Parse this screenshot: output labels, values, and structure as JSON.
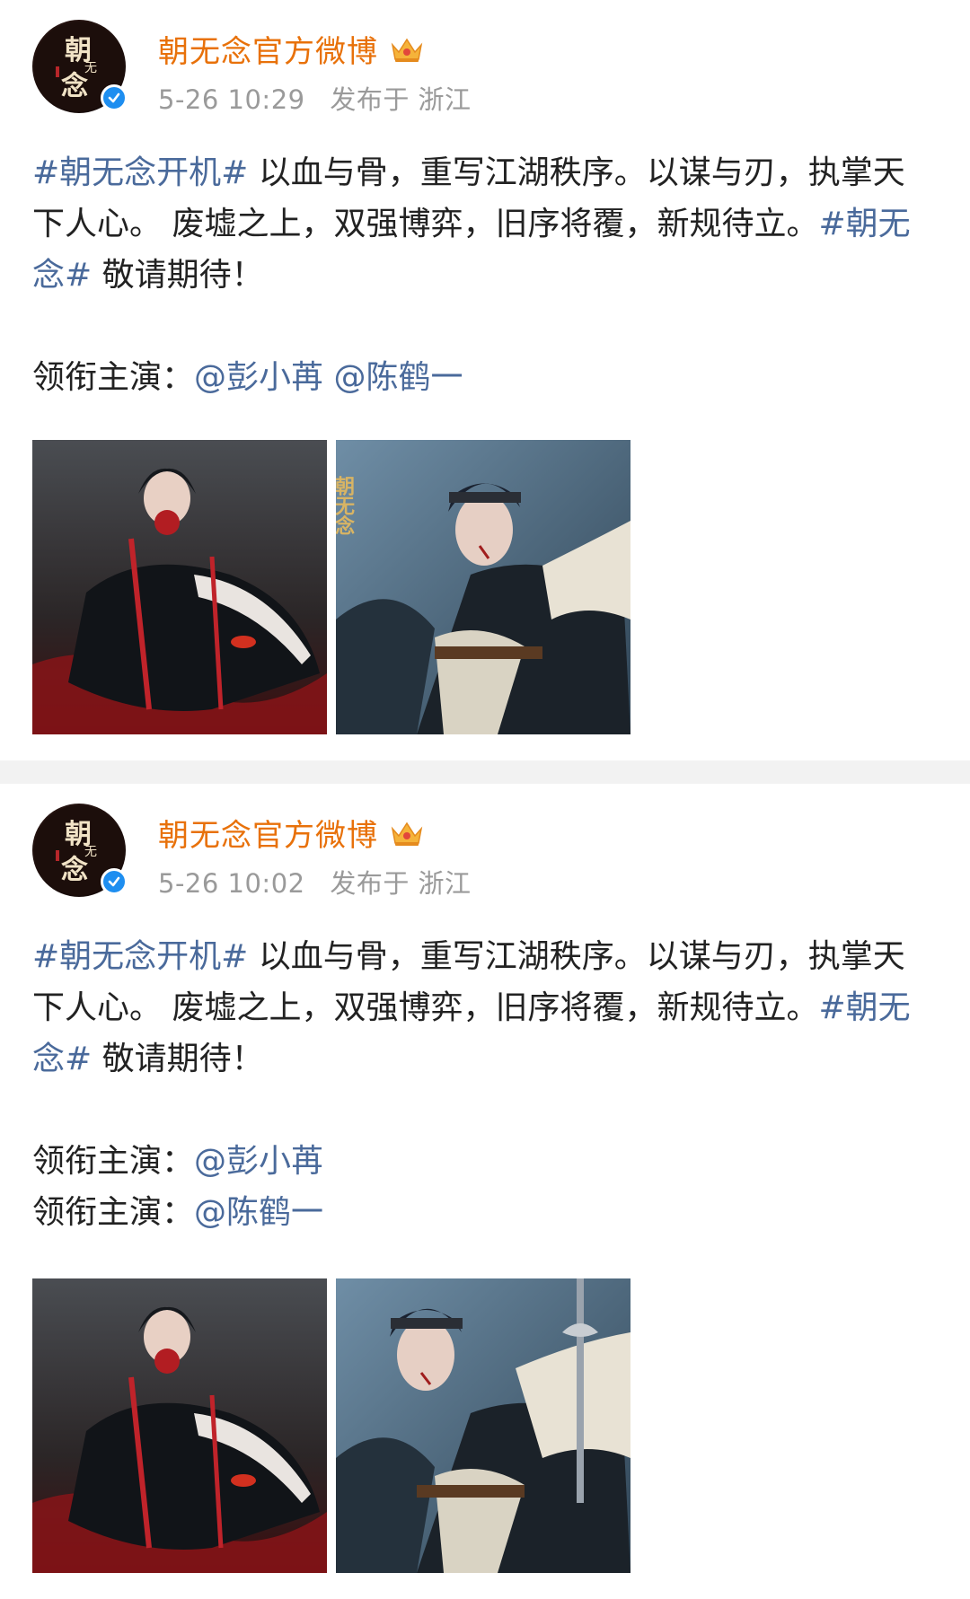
{
  "posts": [
    {
      "account_name": "朝无念官方微博",
      "avatar_text": "朝无念",
      "date": "5-26 10:29",
      "location": "发布于 浙江",
      "line1_tag": "#朝无念开机#",
      "line1_text": " 以血与骨，重写江湖秩序。以谋与刃，执掌天下人心。 废墟之上，双强博弈，旧序将覆，新规待立。",
      "line1_tag2": "#朝无念#",
      "line1_end": " 敬请期待！",
      "cast_label": "领衔主演：",
      "mention1": "@彭小苒",
      "mention2": "@陈鹤一",
      "image1_name": "female-lead-poster",
      "image2_name": "male-lead-poster",
      "image2_caption": "朝无念"
    },
    {
      "account_name": "朝无念官方微博",
      "avatar_text": "朝无念",
      "date": "5-26 10:02",
      "location": "发布于 浙江",
      "line1_tag": "#朝无念开机#",
      "line1_text": " 以血与骨，重写江湖秩序。以谋与刃，执掌天下人心。 废墟之上，双强博弈，旧序将覆，新规待立。",
      "line1_tag2": "#朝无念#",
      "line1_end": " 敬请期待！",
      "cast_label": "领衔主演：",
      "mention1": "@彭小苒",
      "cast_label2": "领衔主演：",
      "mention2": "@陈鹤一"
    }
  ],
  "colors": {
    "account_name": "#e8710a",
    "link": "#4a6a9b",
    "meta": "#9a9a9a",
    "verified": "#1e8ef0"
  },
  "icons": [
    "crown-icon",
    "verified-icon"
  ]
}
